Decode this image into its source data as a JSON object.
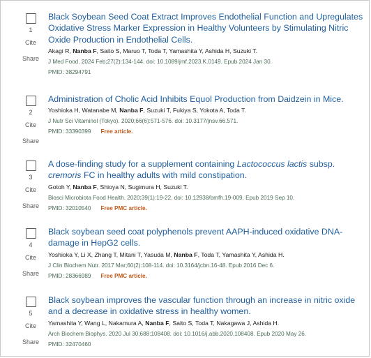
{
  "results": [
    {
      "number": "1",
      "title": "Black Soybean Seed Coat Extract Improves Endothelial Function and Upregulates Oxidative Stress Marker Expression in Healthy Volunteers by Stimulating Nitric Oxide Production in Endothelial Cells.",
      "authors": {
        "before": "Akagi R, ",
        "bold": "Nanba F",
        "after": ", Saito S, Maruo T, Toda T, Yamashita Y, Ashida H, Suzuki T."
      },
      "journal": "J Med Food. 2024 Feb;27(2):134-144. doi: 10.1089/jmf.2023.K.0149. Epub 2024 Jan 30.",
      "pmid": "PMID: 38294791",
      "free": ""
    },
    {
      "number": "2",
      "title": "Administration of Cholic Acid Inhibits Equol Production from Daidzein in Mice.",
      "authors": {
        "before": "Yoshioka H, Watanabe M, ",
        "bold": "Nanba F",
        "after": ", Suzuki T, Fukiya S, Yokota A, Toda T."
      },
      "journal": "J Nutr Sci Vitaminol (Tokyo). 2020;66(6):571-576. doi: 10.3177/jnsv.66.571.",
      "pmid": "PMID: 33390399",
      "free": "Free article."
    },
    {
      "number": "3",
      "title_parts": {
        "pre": "A dose-finding study for a supplement containing ",
        "italic1": "Lactococcus lactis",
        "mid": " subsp. ",
        "italic2": "cremoris",
        "post": " FC in healthy adults with mild constipation."
      },
      "authors": {
        "before": "Gotoh Y, ",
        "bold": "Nanba F",
        "after": ", Shioya N, Sugimura H, Suzuki T."
      },
      "journal": "Biosci Microbiota Food Health. 2020;39(1):19-22. doi: 10.12938/bmfh.19-009. Epub 2019 Sep 10.",
      "pmid": "PMID: 32010540",
      "free": "Free PMC article."
    },
    {
      "number": "4",
      "title": "Black soybean seed coat polyphenols prevent AAPH-induced oxidative DNA-damage in HepG2 cells.",
      "authors": {
        "before": "Yoshioka Y, Li X, Zhang T, Mitani T, Yasuda M, ",
        "bold": "Nanba F",
        "after": ", Toda T, Yamashita Y, Ashida H."
      },
      "journal": "J Clin Biochem Nutr. 2017 Mar;60(2):108-114. doi: 10.3164/jcbn.16-48. Epub 2016 Dec 6.",
      "pmid": "PMID: 28366989",
      "free": "Free PMC article."
    },
    {
      "number": "5",
      "title": "Black soybean improves the vascular function through an increase in nitric oxide and a decrease in oxidative stress in healthy women.",
      "authors": {
        "before": "Yamashita Y, Wang L, Nakamura A, ",
        "bold": "Nanba F",
        "after": ", Saito S, Toda T, Nakagawa J, Ashida H."
      },
      "journal": "Arch Biochem Biophys. 2020 Jul 30;688:108408. doi: 10.1016/j.abb.2020.108408. Epub 2020 May 26.",
      "pmid": "PMID: 32470460",
      "free": ""
    }
  ],
  "labels": {
    "cite": "Cite",
    "share": "Share"
  }
}
